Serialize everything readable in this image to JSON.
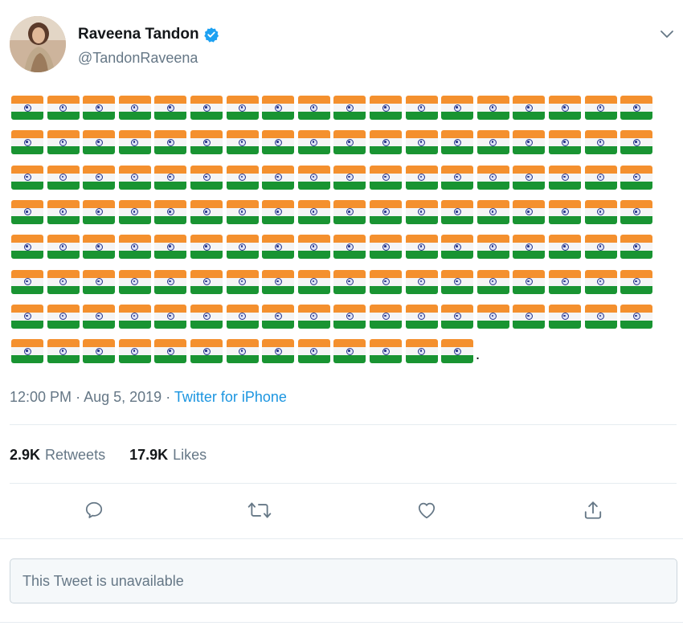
{
  "tweet": {
    "author": {
      "display_name": "Raveena Tandon",
      "handle": "@TandonRaveena",
      "verified": true,
      "avatar_icon": "profile-photo"
    },
    "content": {
      "emoji": "🇮🇳",
      "flag_rows": [
        18,
        18,
        18,
        18,
        18,
        18,
        18,
        13
      ],
      "trailing_text": "."
    },
    "time": "12:00 PM",
    "separator": "·",
    "date": "Aug 5, 2019",
    "source": "Twitter for iPhone",
    "stats": {
      "retweets_count": "2.9K",
      "retweets_label": "Retweets",
      "likes_count": "17.9K",
      "likes_label": "Likes"
    },
    "actions": [
      "reply-icon",
      "retweet-icon",
      "like-icon",
      "share-icon"
    ],
    "quoted_tweet": {
      "text": "This Tweet is unavailable"
    }
  },
  "colors": {
    "saffron": "#f4902e",
    "white": "#f5f5f5",
    "green": "#199432",
    "chakra_blue": "#27358a",
    "link_blue": "#1b95e0",
    "verified_blue": "#1da1f2",
    "muted_text": "#657786",
    "icon_gray": "#657786"
  }
}
